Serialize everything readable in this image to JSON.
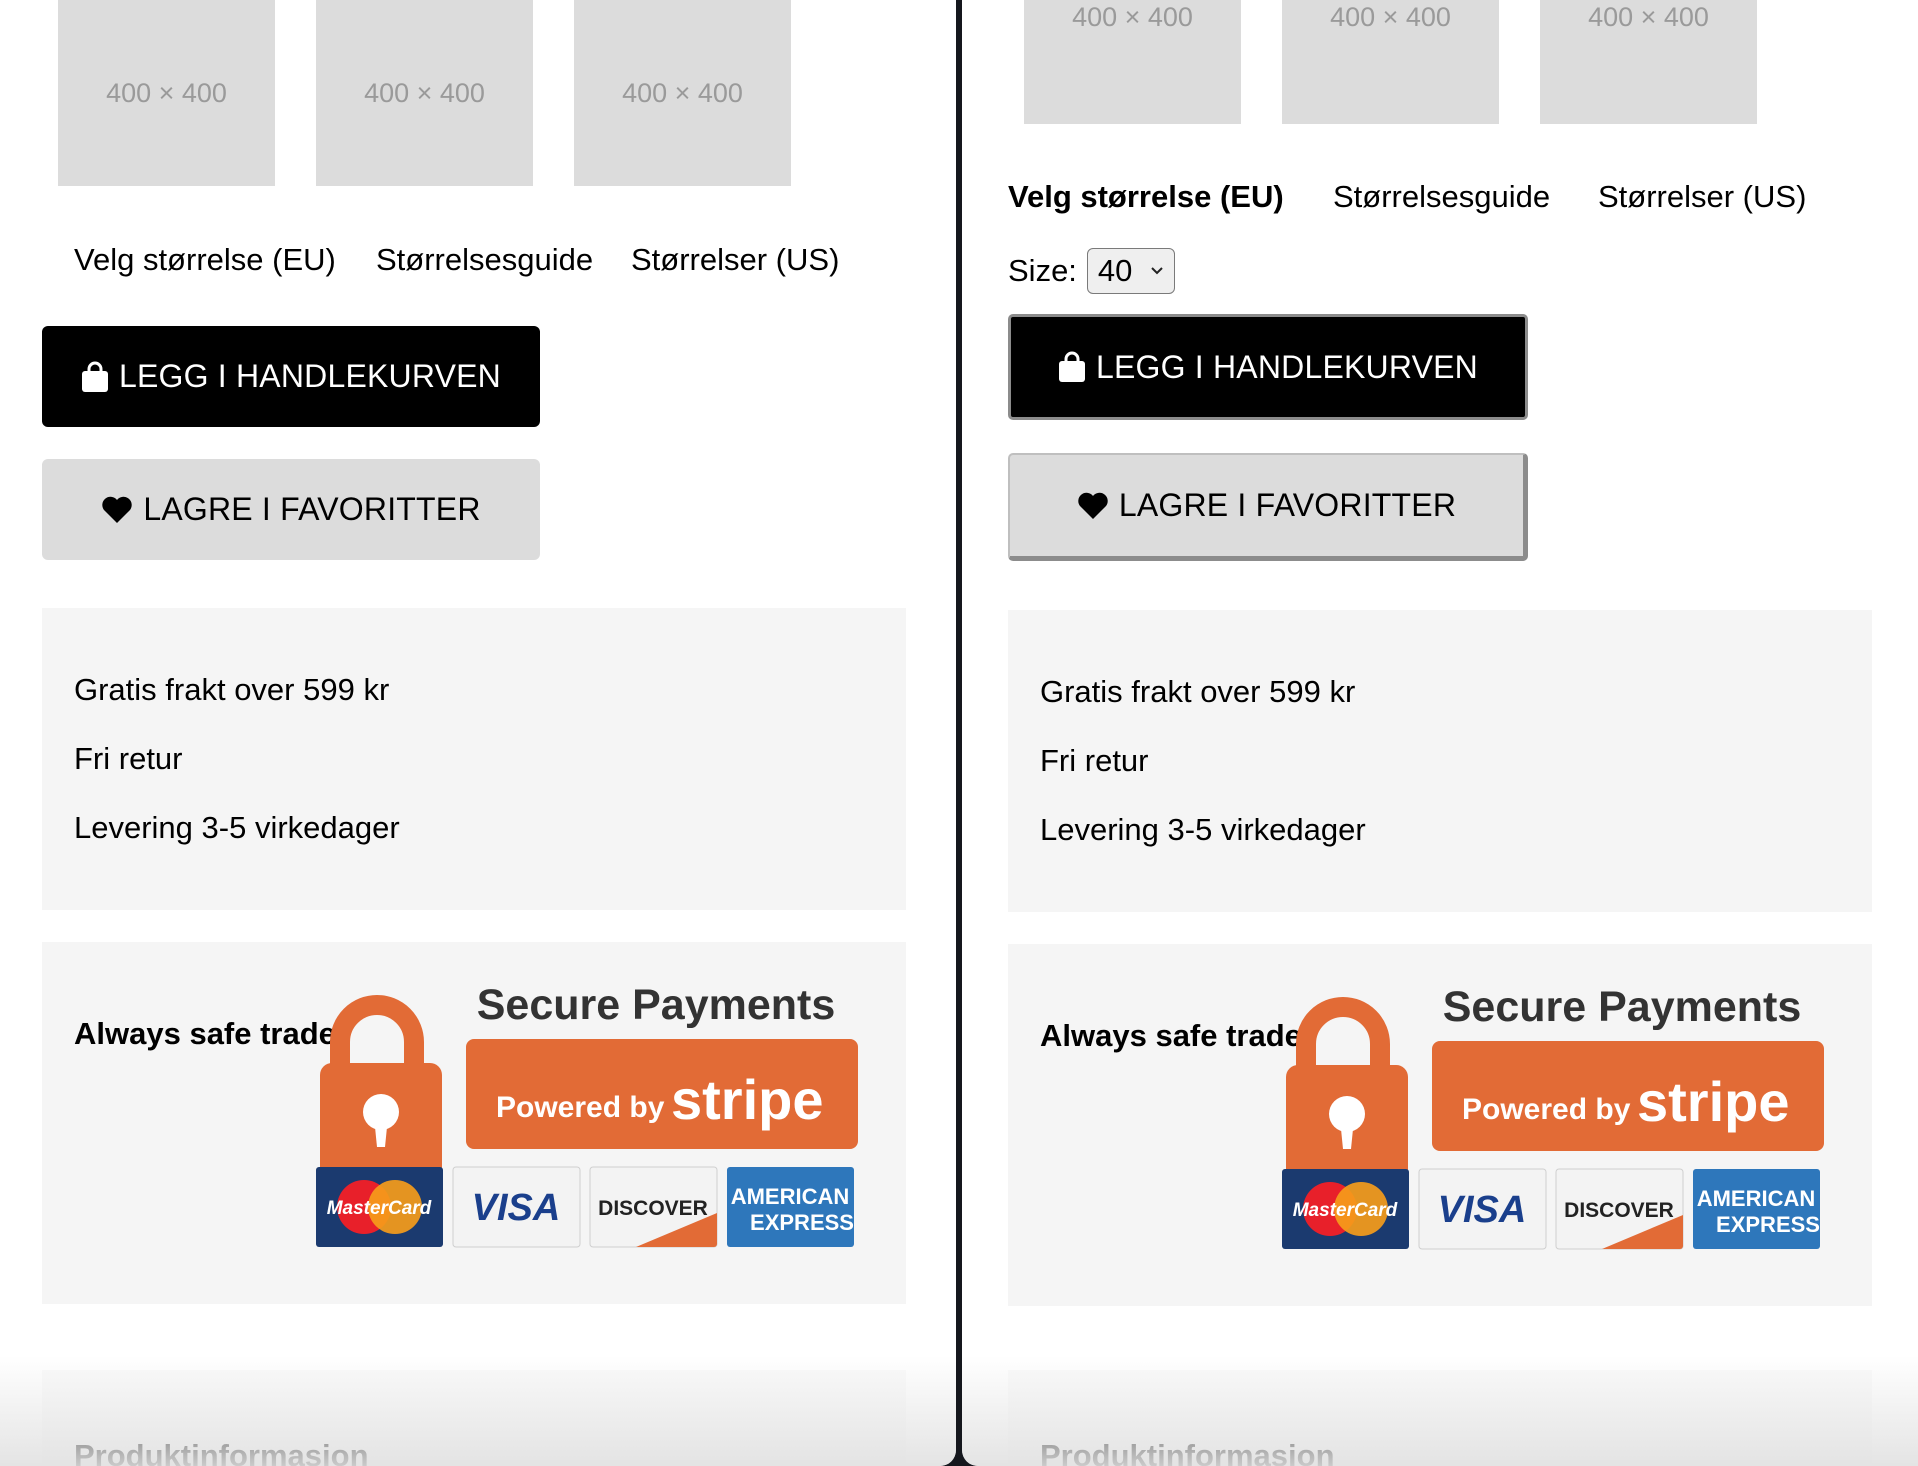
{
  "thumbnails": [
    "400 × 400",
    "400 × 400",
    "400 × 400"
  ],
  "size_tabs": [
    "Velg størrelse (EU)",
    "Størrelsesguide",
    "Størrelser (US)"
  ],
  "size_select": {
    "label": "Size:",
    "value": "40"
  },
  "buttons": {
    "add_to_cart": "LEGG I HANDLEKURVEN",
    "save_favorite": "LAGRE I FAVORITTER"
  },
  "shipping_info": [
    "Gratis frakt over 599 kr",
    "Fri retur",
    "Levering 3-5 virkedager"
  ],
  "safe_trade": {
    "title": "Always safe trade",
    "badge_heading": "Secure Payments",
    "badge_powered": "Powered by",
    "badge_brand": "stripe",
    "cards": [
      "MasterCard",
      "VISA",
      "DISCOVER",
      "AMERICAN",
      "EXPRESS"
    ]
  },
  "product_info_title": "Produktinformasjon",
  "colors": {
    "stripe_orange": "#e26b36",
    "amex_blue": "#2e77bb",
    "box_bg": "#f5f5f5",
    "placeholder_bg": "#dcdcdc"
  }
}
